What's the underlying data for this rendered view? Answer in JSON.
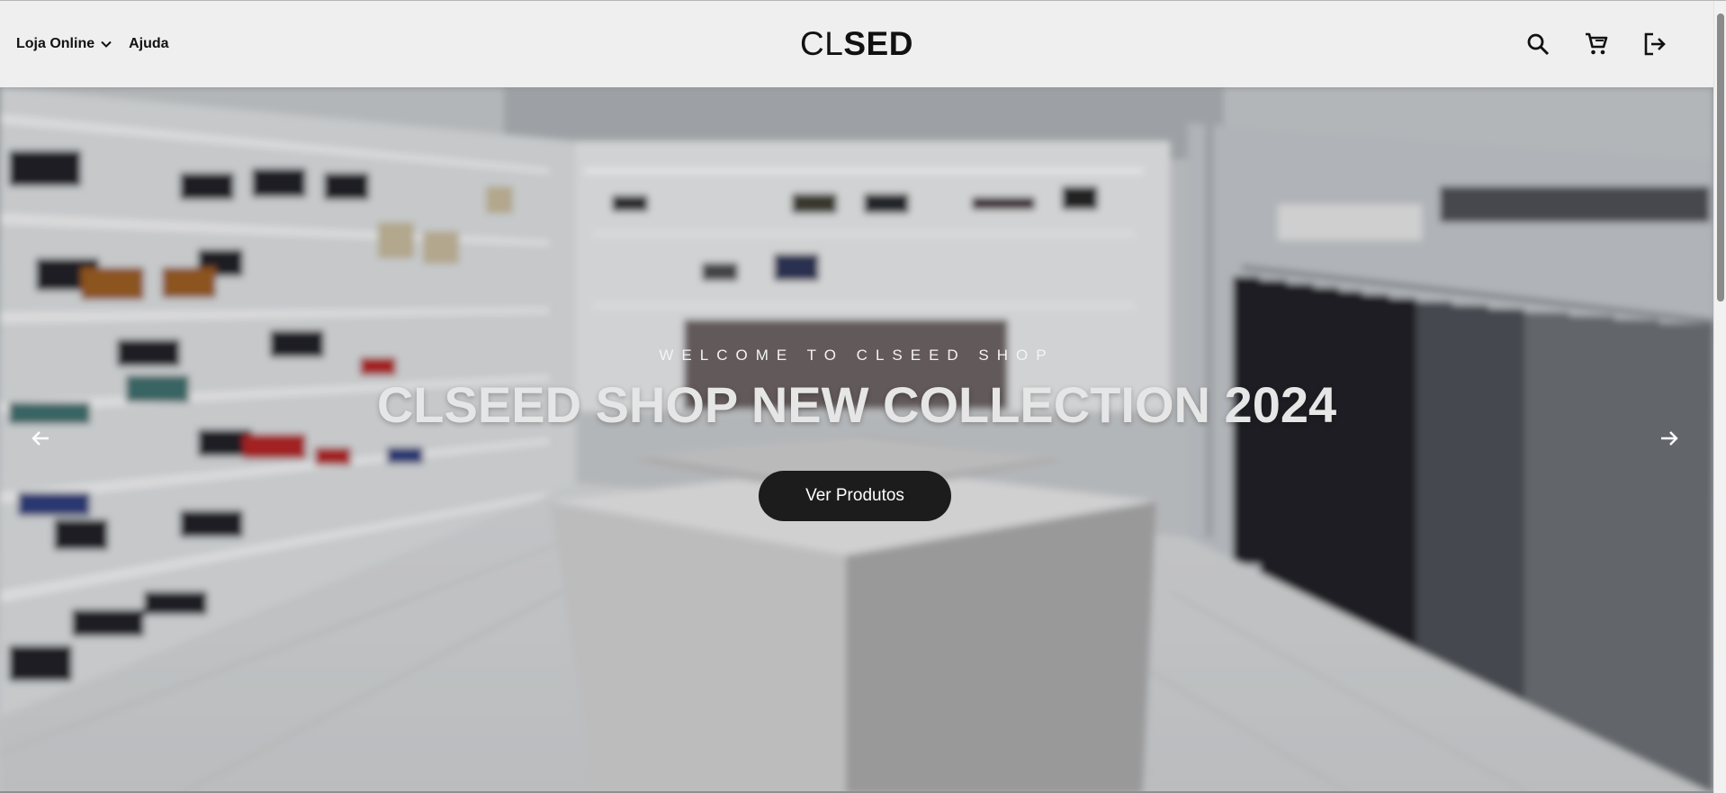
{
  "header": {
    "nav_left": [
      {
        "label": "Loja Online",
        "has_dropdown": true
      },
      {
        "label": "Ajuda",
        "has_dropdown": false
      }
    ],
    "logo_light": "CL",
    "logo_bold": "SED",
    "icons": [
      "search-icon",
      "cart-icon",
      "logout-icon"
    ]
  },
  "hero": {
    "eyebrow": "WELCOME TO CLSEED SHOP",
    "title": "CLSEED SHOP NEW COLLECTION 2024",
    "cta_label": "Ver Produtos",
    "prev_icon": "arrow-left-icon",
    "next_icon": "arrow-right-icon"
  },
  "colors": {
    "header_bg": "#efefef",
    "cta_bg": "#1c1c1c",
    "text_dark": "#111111"
  }
}
